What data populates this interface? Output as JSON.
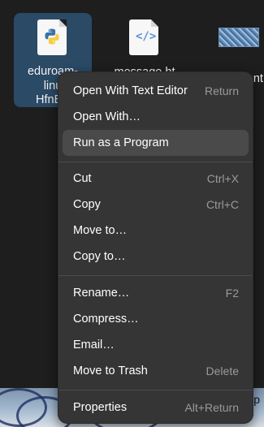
{
  "desktop": {
    "icons": [
      {
        "name": "eduroam-linux-HfnEE",
        "label_line1": "eduroam-",
        "label_line2": "linu",
        "label_line3": "HfnEE",
        "type": "python-script",
        "icon": "python-icon"
      },
      {
        "name": "message.ht",
        "label": "message.ht",
        "type": "html-file",
        "icon": "html-file-icon"
      },
      {
        "name": "Unbenannt",
        "label": "Unbenannt",
        "type": "image-file",
        "icon": "image-thumbnail-icon"
      }
    ]
  },
  "taskbar": {
    "partial_label": "E.p"
  },
  "context_menu": {
    "items": [
      {
        "label": "Open With Text Editor",
        "shortcut": "Return"
      },
      {
        "label": "Open With…",
        "shortcut": ""
      },
      {
        "label": "Run as a Program",
        "shortcut": "",
        "highlighted": true
      },
      {
        "label": "Cut",
        "shortcut": "Ctrl+X"
      },
      {
        "label": "Copy",
        "shortcut": "Ctrl+C"
      },
      {
        "label": "Move to…",
        "shortcut": ""
      },
      {
        "label": "Copy to…",
        "shortcut": ""
      },
      {
        "label": "Rename…",
        "shortcut": "F2"
      },
      {
        "label": "Compress…",
        "shortcut": ""
      },
      {
        "label": "Email…",
        "shortcut": ""
      },
      {
        "label": "Move to Trash",
        "shortcut": "Delete"
      },
      {
        "label": "Properties",
        "shortcut": "Alt+Return"
      }
    ]
  },
  "colors": {
    "desktop_bg": "#1e1e1e",
    "menu_bg": "#353535",
    "menu_hover": "#4a4a4a",
    "selected_icon_bg": "#2a4a66",
    "python_blue": "#3a73a8",
    "python_yellow": "#f5cf40",
    "html_blue": "#5b8fdc"
  }
}
